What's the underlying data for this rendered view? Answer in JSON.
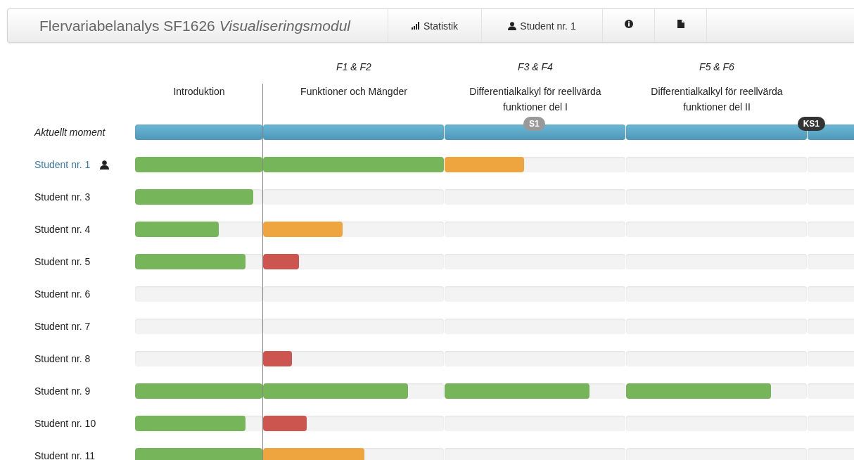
{
  "navbar": {
    "title": "Flervariabelanalys SF1626",
    "subtitle": "Visualiseringsmodul",
    "items": [
      {
        "kind": "chart",
        "label": "Statistik"
      },
      {
        "kind": "user",
        "label": "Student nr. 1"
      },
      {
        "kind": "info"
      },
      {
        "kind": "file"
      }
    ]
  },
  "columns": [
    {
      "title": "Introduktion"
    },
    {
      "lectures": "F1 & F2",
      "title": "Funktioner och Mängder"
    },
    {
      "lectures": "F3 & F4",
      "title": "Differentialkalkyl för reellvärda funktioner del I"
    },
    {
      "lectures": "F5 & F6",
      "title": "Differentialkalkyl för reellvärda funktioner del II"
    }
  ],
  "current_moment": {
    "label": "Aktuellt moment",
    "segments": [
      {
        "kind": "plain"
      },
      {
        "kind": "plain"
      },
      {
        "kind": "milestone",
        "badge": {
          "text": "S1",
          "kind": "light"
        }
      },
      {
        "kind": "milestone",
        "badge": {
          "text": "KS1",
          "kind": "dark"
        }
      },
      {
        "kind": "plain"
      }
    ]
  },
  "students": [
    {
      "name": "Student nr. 1",
      "selected": true,
      "segments": [
        {
          "kind": "progress",
          "level": 1,
          "color": "#77b55a"
        },
        {
          "kind": "progress",
          "level": 1,
          "color": "#77b55a"
        },
        {
          "kind": "progress",
          "level": 0.44,
          "color": "#eea540"
        },
        {
          "kind": "empty"
        },
        {
          "kind": "empty"
        }
      ]
    },
    {
      "name": "Student nr. 3",
      "selected": false,
      "segments": [
        {
          "kind": "progress",
          "level": 0.93,
          "color": "#77b55a"
        },
        {
          "kind": "empty"
        },
        {
          "kind": "empty"
        },
        {
          "kind": "empty"
        },
        {
          "kind": "empty"
        }
      ]
    },
    {
      "name": "Student nr. 4",
      "selected": false,
      "segments": [
        {
          "kind": "progress",
          "level": 0.66,
          "color": "#77b55a"
        },
        {
          "kind": "progress",
          "level": 0.44,
          "color": "#eea540"
        },
        {
          "kind": "empty"
        },
        {
          "kind": "empty"
        },
        {
          "kind": "empty"
        }
      ]
    },
    {
      "name": "Student nr. 5",
      "selected": false,
      "segments": [
        {
          "kind": "progress",
          "level": 0.87,
          "color": "#77b55a"
        },
        {
          "kind": "progress",
          "level": 0.2,
          "color": "#cc5550"
        },
        {
          "kind": "empty"
        },
        {
          "kind": "empty"
        },
        {
          "kind": "empty"
        }
      ]
    },
    {
      "name": "Student nr. 6",
      "selected": false,
      "segments": [
        {
          "kind": "empty"
        },
        {
          "kind": "empty"
        },
        {
          "kind": "empty"
        },
        {
          "kind": "empty"
        },
        {
          "kind": "empty"
        }
      ]
    },
    {
      "name": "Student nr. 7",
      "selected": false,
      "segments": [
        {
          "kind": "empty"
        },
        {
          "kind": "empty"
        },
        {
          "kind": "empty"
        },
        {
          "kind": "empty"
        },
        {
          "kind": "empty"
        }
      ]
    },
    {
      "name": "Student nr. 8",
      "selected": false,
      "segments": [
        {
          "kind": "empty"
        },
        {
          "kind": "progress",
          "level": 0.16,
          "color": "#cc5550"
        },
        {
          "kind": "empty"
        },
        {
          "kind": "empty"
        },
        {
          "kind": "empty"
        }
      ]
    },
    {
      "name": "Student nr. 9",
      "selected": false,
      "segments": [
        {
          "kind": "progress",
          "level": 1,
          "color": "#77b55a"
        },
        {
          "kind": "progress",
          "level": 0.8,
          "color": "#77b55a"
        },
        {
          "kind": "progress",
          "level": 0.8,
          "color": "#77b55a"
        },
        {
          "kind": "progress",
          "level": 0.8,
          "color": "#77b55a"
        },
        {
          "kind": "empty"
        }
      ]
    },
    {
      "name": "Student nr. 10",
      "selected": false,
      "segments": [
        {
          "kind": "progress",
          "level": 0.87,
          "color": "#77b55a"
        },
        {
          "kind": "progress",
          "level": 0.24,
          "color": "#cc5550"
        },
        {
          "kind": "empty"
        },
        {
          "kind": "empty"
        },
        {
          "kind": "empty"
        }
      ]
    },
    {
      "name": "Student nr. 11",
      "selected": false,
      "segments": [
        {
          "kind": "progress",
          "level": 1,
          "color": "#77b55a"
        },
        {
          "kind": "progress",
          "level": 0.56,
          "color": "#eea540"
        },
        {
          "kind": "empty"
        },
        {
          "kind": "empty"
        },
        {
          "kind": "empty"
        }
      ]
    }
  ]
}
